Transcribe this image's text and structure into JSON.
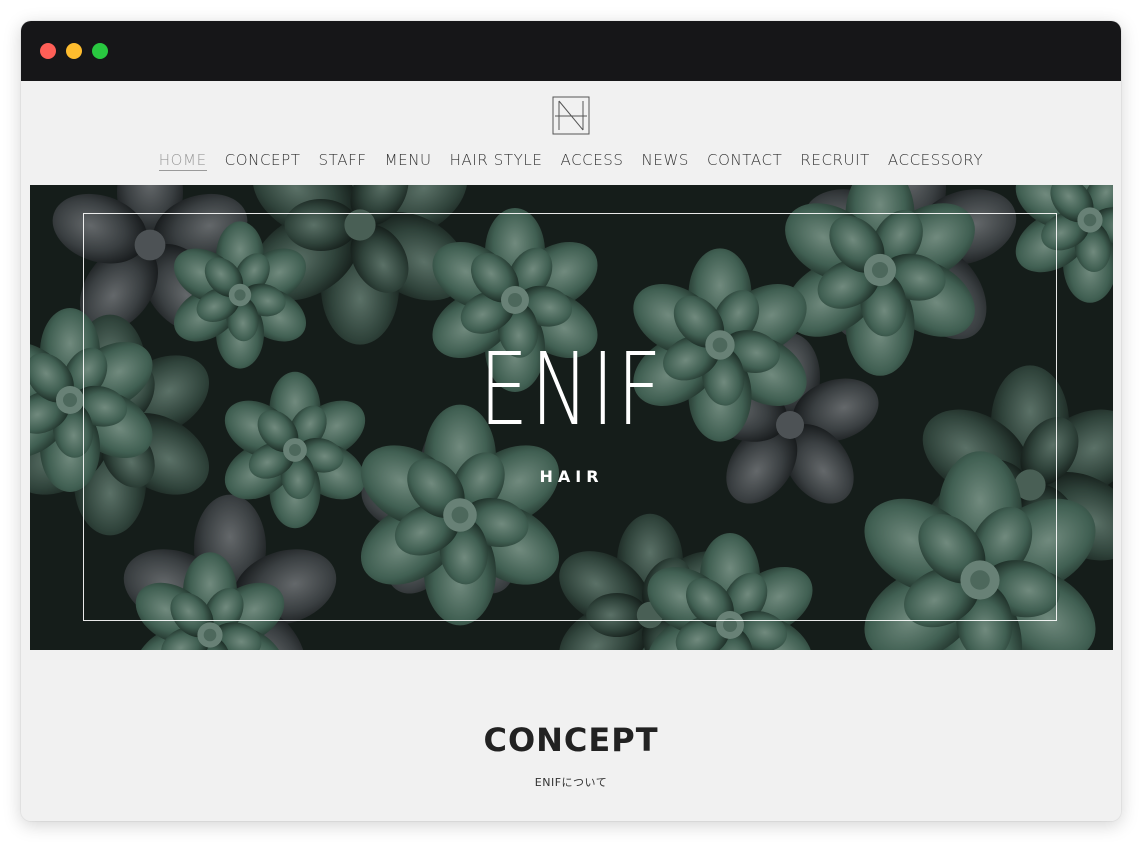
{
  "window": {
    "controls": [
      "close",
      "minimize",
      "maximize"
    ],
    "colors": {
      "close": "#fe5f57",
      "minimize": "#febc2e",
      "maximize": "#29c840"
    }
  },
  "site": {
    "logo_icon": "enif-logo-mark",
    "nav": [
      {
        "label": "HOME",
        "active": true
      },
      {
        "label": "CONCEPT"
      },
      {
        "label": "STAFF"
      },
      {
        "label": "MENU"
      },
      {
        "label": "HAIR STYLE"
      },
      {
        "label": "ACCESS"
      },
      {
        "label": "NEWS"
      },
      {
        "label": "CONTACT"
      },
      {
        "label": "RECRUIT"
      },
      {
        "label": "ACCESSORY"
      }
    ],
    "hero": {
      "title": "ENIF",
      "subtitle": "HAIR",
      "background": "succulent-plants-photo"
    },
    "concept": {
      "title": "CONCEPT",
      "subtitle": "ENIFについて"
    }
  }
}
